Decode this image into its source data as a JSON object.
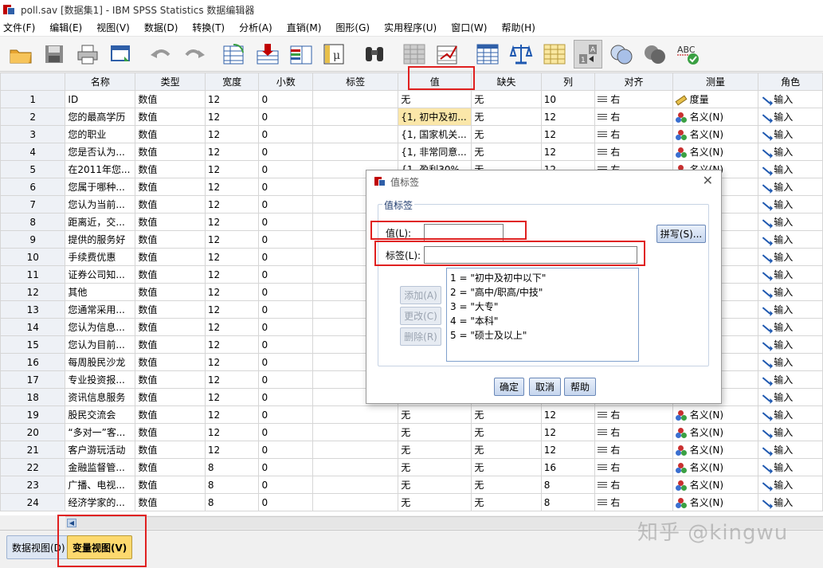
{
  "window": {
    "title": "poll.sav [数据集1] - IBM SPSS Statistics 数据编辑器"
  },
  "menu": [
    "文件(F)",
    "编辑(E)",
    "视图(V)",
    "数据(D)",
    "转换(T)",
    "分析(A)",
    "直销(M)",
    "图形(G)",
    "实用程序(U)",
    "窗口(W)",
    "帮助(H)"
  ],
  "toolbar": {
    "icons": [
      "open-file",
      "save",
      "print",
      "recall-dialog",
      "undo",
      "redo",
      "goto-case",
      "goto-variable",
      "variables",
      "go-to-data",
      "find",
      "insert-cases",
      "insert-variable",
      "split-file",
      "weight-cases",
      "select-cases",
      "value-labels",
      "use-variable-sets",
      "show-all-variables",
      "spell-check"
    ],
    "spell_label": "ABC"
  },
  "grid": {
    "columns": [
      "名称",
      "类型",
      "宽度",
      "小数",
      "标签",
      "值",
      "缺失",
      "列",
      "对齐",
      "测量",
      "角色"
    ],
    "rows": [
      {
        "n": "1",
        "name": "ID",
        "type": "数值",
        "width": "12",
        "dec": "0",
        "label": "",
        "values": "无",
        "missing": "无",
        "cols": "10",
        "align": "右",
        "measure": "度量",
        "measure_kind": "scale",
        "role": "输入"
      },
      {
        "n": "2",
        "name": "您的最高学历",
        "type": "数值",
        "width": "12",
        "dec": "0",
        "label": "",
        "values": "{1, 初中及初...",
        "missing": "无",
        "cols": "12",
        "align": "右",
        "measure": "名义(N)",
        "measure_kind": "nominal",
        "role": "输入"
      },
      {
        "n": "3",
        "name": "您的职业",
        "type": "数值",
        "width": "12",
        "dec": "0",
        "label": "",
        "values": "{1, 国家机关...",
        "missing": "无",
        "cols": "12",
        "align": "右",
        "measure": "名义(N)",
        "measure_kind": "nominal",
        "role": "输入"
      },
      {
        "n": "4",
        "name": "您是否认为...",
        "type": "数值",
        "width": "12",
        "dec": "0",
        "label": "",
        "values": "{1, 非常同意...",
        "missing": "无",
        "cols": "12",
        "align": "右",
        "measure": "名义(N)",
        "measure_kind": "nominal",
        "role": "输入"
      },
      {
        "n": "5",
        "name": "在2011年您...",
        "type": "数值",
        "width": "12",
        "dec": "0",
        "label": "",
        "values": "{1, 盈利30%...",
        "missing": "无",
        "cols": "12",
        "align": "右",
        "measure": "名义(N)",
        "measure_kind": "nominal",
        "role": "输入"
      },
      {
        "n": "6",
        "name": "您属于哪种...",
        "type": "数值",
        "width": "12",
        "dec": "0",
        "label": "",
        "values": "",
        "missing": "",
        "cols": "",
        "align": "",
        "measure": "",
        "measure_kind": "",
        "role": "输入"
      },
      {
        "n": "7",
        "name": "您认为当前...",
        "type": "数值",
        "width": "12",
        "dec": "0",
        "label": "",
        "values": "",
        "missing": "",
        "cols": "",
        "align": "",
        "measure": "",
        "measure_kind": "",
        "role": "输入"
      },
      {
        "n": "8",
        "name": "距离近，交...",
        "type": "数值",
        "width": "12",
        "dec": "0",
        "label": "",
        "values": "",
        "missing": "",
        "cols": "",
        "align": "",
        "measure": "",
        "measure_kind": "",
        "role": "输入"
      },
      {
        "n": "9",
        "name": "提供的服务好",
        "type": "数值",
        "width": "12",
        "dec": "0",
        "label": "",
        "values": "",
        "missing": "",
        "cols": "",
        "align": "",
        "measure": "",
        "measure_kind": "",
        "role": "输入"
      },
      {
        "n": "10",
        "name": "手续费优惠",
        "type": "数值",
        "width": "12",
        "dec": "0",
        "label": "",
        "values": "",
        "missing": "",
        "cols": "",
        "align": "",
        "measure": "",
        "measure_kind": "",
        "role": "输入"
      },
      {
        "n": "11",
        "name": "证券公司知...",
        "type": "数值",
        "width": "12",
        "dec": "0",
        "label": "",
        "values": "",
        "missing": "",
        "cols": "",
        "align": "",
        "measure": "",
        "measure_kind": "",
        "role": "输入"
      },
      {
        "n": "12",
        "name": "其他",
        "type": "数值",
        "width": "12",
        "dec": "0",
        "label": "",
        "values": "",
        "missing": "",
        "cols": "",
        "align": "",
        "measure": "",
        "measure_kind": "",
        "role": "输入"
      },
      {
        "n": "13",
        "name": "您通常采用...",
        "type": "数值",
        "width": "12",
        "dec": "0",
        "label": "",
        "values": "",
        "missing": "",
        "cols": "",
        "align": "",
        "measure": "",
        "measure_kind": "",
        "role": "输入"
      },
      {
        "n": "14",
        "name": "您认为信息...",
        "type": "数值",
        "width": "12",
        "dec": "0",
        "label": "",
        "values": "",
        "missing": "",
        "cols": "",
        "align": "",
        "measure": "",
        "measure_kind": "",
        "role": "输入"
      },
      {
        "n": "15",
        "name": "您认为目前...",
        "type": "数值",
        "width": "12",
        "dec": "0",
        "label": "",
        "values": "",
        "missing": "",
        "cols": "",
        "align": "",
        "measure": "",
        "measure_kind": "",
        "role": "输入"
      },
      {
        "n": "16",
        "name": "每周股民沙龙",
        "type": "数值",
        "width": "12",
        "dec": "0",
        "label": "",
        "values": "",
        "missing": "",
        "cols": "",
        "align": "",
        "measure": "",
        "measure_kind": "",
        "role": "输入"
      },
      {
        "n": "17",
        "name": "专业投资报...",
        "type": "数值",
        "width": "12",
        "dec": "0",
        "label": "",
        "values": "",
        "missing": "",
        "cols": "",
        "align": "",
        "measure": "",
        "measure_kind": "",
        "role": "输入"
      },
      {
        "n": "18",
        "name": "资讯信息服务",
        "type": "数值",
        "width": "12",
        "dec": "0",
        "label": "",
        "values": "",
        "missing": "",
        "cols": "",
        "align": "",
        "measure": "",
        "measure_kind": "",
        "role": "输入"
      },
      {
        "n": "19",
        "name": "股民交流会",
        "type": "数值",
        "width": "12",
        "dec": "0",
        "label": "",
        "values": "无",
        "missing": "无",
        "cols": "12",
        "align": "右",
        "measure": "名义(N)",
        "measure_kind": "nominal",
        "role": "输入"
      },
      {
        "n": "20",
        "name": "“多对一”客...",
        "type": "数值",
        "width": "12",
        "dec": "0",
        "label": "",
        "values": "无",
        "missing": "无",
        "cols": "12",
        "align": "右",
        "measure": "名义(N)",
        "measure_kind": "nominal",
        "role": "输入"
      },
      {
        "n": "21",
        "name": "客户游玩活动",
        "type": "数值",
        "width": "12",
        "dec": "0",
        "label": "",
        "values": "无",
        "missing": "无",
        "cols": "12",
        "align": "右",
        "measure": "名义(N)",
        "measure_kind": "nominal",
        "role": "输入"
      },
      {
        "n": "22",
        "name": "金融监督管...",
        "type": "数值",
        "width": "8",
        "dec": "0",
        "label": "",
        "values": "无",
        "missing": "无",
        "cols": "16",
        "align": "右",
        "measure": "名义(N)",
        "measure_kind": "nominal",
        "role": "输入"
      },
      {
        "n": "23",
        "name": "广播、电视...",
        "type": "数值",
        "width": "8",
        "dec": "0",
        "label": "",
        "values": "无",
        "missing": "无",
        "cols": "8",
        "align": "右",
        "measure": "名义(N)",
        "measure_kind": "nominal",
        "role": "输入"
      },
      {
        "n": "24",
        "name": "经济学家的...",
        "type": "数值",
        "width": "8",
        "dec": "0",
        "label": "",
        "values": "无",
        "missing": "无",
        "cols": "8",
        "align": "右",
        "measure": "名义(N)",
        "measure_kind": "nominal",
        "role": "输入"
      }
    ]
  },
  "tabs": {
    "data_view": "数据视图(D)",
    "variable_view": "变量视图(V)"
  },
  "dialog": {
    "title": "值标签",
    "group_label": "值标签",
    "value_label": "值(L):",
    "value_input": "",
    "label_label": "标签(L):",
    "label_input": "",
    "spell_button": "拼写(S)...",
    "add_button": "添加(A)",
    "change_button": "更改(C)",
    "remove_button": "删除(R)",
    "list": [
      "1 = \"初中及初中以下\"",
      "2 = \"高中/职高/中技\"",
      "3 = \"大专\"",
      "4 = \"本科\"",
      "5 = \"硕士及以上\""
    ],
    "ok_button": "确定",
    "cancel_button": "取消",
    "help_button": "帮助"
  },
  "watermark": "知乎 @kingwu"
}
